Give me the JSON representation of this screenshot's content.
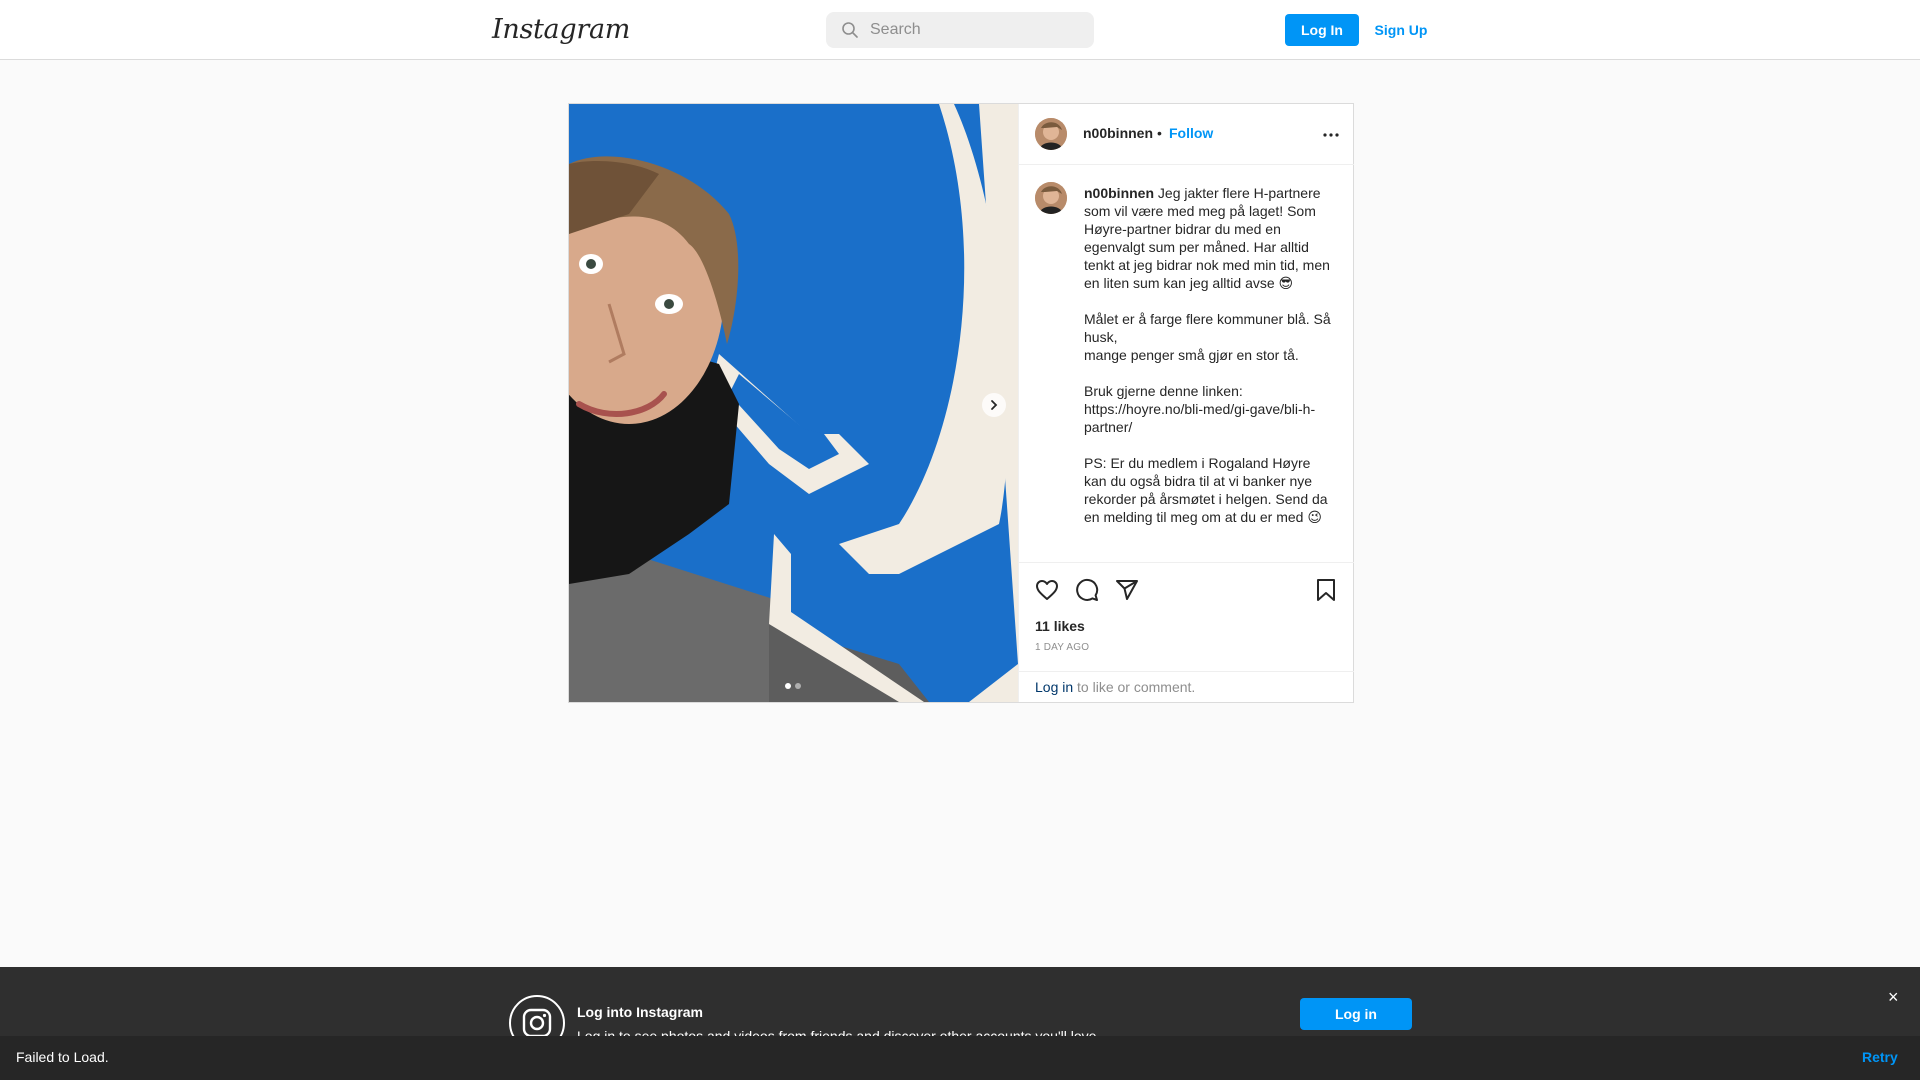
{
  "header": {
    "logo_text": "Instagram",
    "search_placeholder": "Search",
    "login_label": "Log In",
    "signup_label": "Sign Up"
  },
  "post": {
    "username": "n00binnen",
    "separator": "•",
    "follow_label": "Follow",
    "caption_text": " Jeg jakter flere H-partnere som vil være med meg på laget! Som Høyre-partner bidrar du med en egenvalgt sum per måned. Har alltid tenkt at jeg bidrar nok med min tid, men en liten sum kan jeg alltid avse 😎\n\nMålet er å farge flere kommuner blå. Så husk,\nmange penger små gjør en stor tå.\n\nBruk gjerne denne linken: https://hoyre.no/bli-med/gi-gave/bli-h-partner/\n\nPS: Er du medlem i Rogaland Høyre kan du også bidra til at vi banker nye rekorder på årsmøtet i helgen. Send da en melding til meg om at du er med 😉",
    "likes": "11 likes",
    "time_ago": "1 DAY AGO",
    "login_link": "Log in",
    "login_suffix": " to like or comment.",
    "carousel": {
      "current": 1,
      "total": 2
    }
  },
  "banner": {
    "title": "Log into Instagram",
    "subtitle": "Log in to see photos and videos from friends and discover other accounts you'll love.",
    "login_label": "Log in",
    "close_label": "×"
  },
  "toast": {
    "message": "Failed to Load.",
    "retry_label": "Retry"
  },
  "colors": {
    "accent": "#0095f6",
    "link_dark": "#00376b"
  }
}
